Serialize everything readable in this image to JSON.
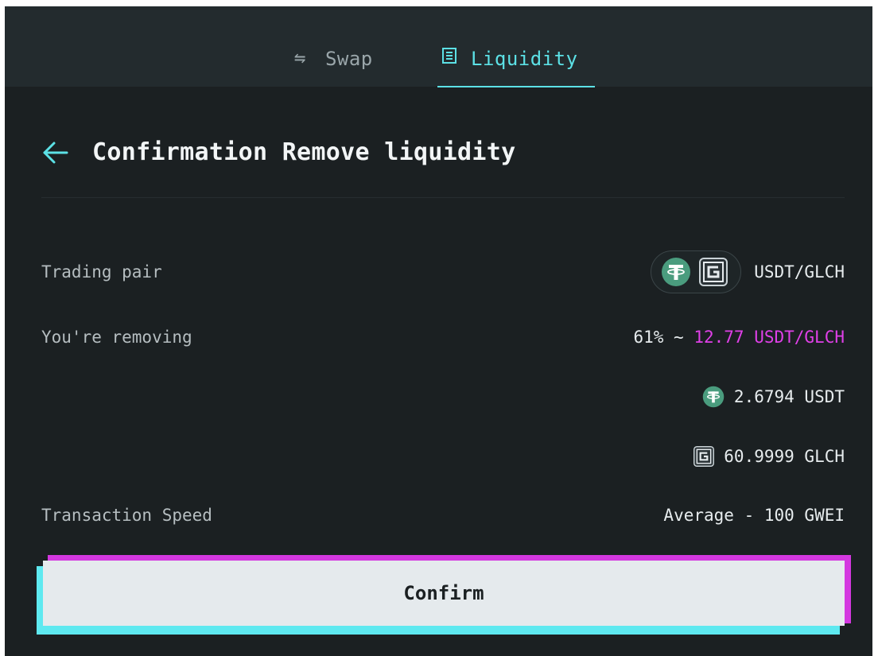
{
  "tabs": [
    {
      "label": "Swap",
      "icon": "swap-arrows-icon",
      "active": false
    },
    {
      "label": "Liquidity",
      "icon": "liquidity-icon",
      "active": true
    }
  ],
  "header": {
    "title": "Confirmation Remove liquidity",
    "back_icon": "arrow-left-icon"
  },
  "details": {
    "trading_pair": {
      "label": "Trading pair",
      "value": "USDT/GLCH",
      "icons": [
        "usdt-icon",
        "glch-icon"
      ]
    },
    "removing": {
      "label": "You're removing",
      "percent_text": "61% ~ ",
      "amount_text": "12.77 USDT/GLCH"
    },
    "usdt_amount": {
      "value": "2.6794 USDT",
      "icon": "usdt-icon"
    },
    "glch_amount": {
      "value": "60.9999 GLCH",
      "icon": "glch-icon"
    },
    "speed": {
      "label": "Transaction Speed",
      "value": "Average - 100 GWEI"
    }
  },
  "confirm": {
    "label": "Confirm"
  },
  "colors": {
    "background": "#1b2022",
    "tabbar": "#232b2e",
    "accent_cyan": "#5ce1e6",
    "accent_magenta": "#e040e8",
    "usdt_green": "#4a9c7e",
    "button_bg": "#e5eaed"
  }
}
